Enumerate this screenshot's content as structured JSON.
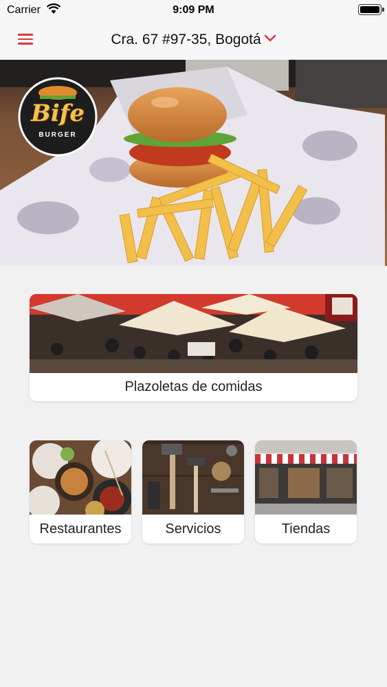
{
  "status_bar": {
    "carrier": "Carrier",
    "time": "9:09 PM"
  },
  "nav": {
    "address": "Cra. 67 #97-35, Bogotá",
    "accent_color": "#e0353f"
  },
  "hero": {
    "logo_text": "Bife",
    "logo_subtext": "BURGER",
    "carousel_pages": 6,
    "carousel_active": 0
  },
  "categories": {
    "featured": {
      "label": "Plazoletas de comidas",
      "image": "food-court-umbrellas"
    },
    "items": [
      {
        "label": "Restaurantes",
        "image": "restaurant-dishes"
      },
      {
        "label": "Servicios",
        "image": "tools-on-wood"
      },
      {
        "label": "Tiendas",
        "image": "storefront-awnings"
      }
    ]
  }
}
